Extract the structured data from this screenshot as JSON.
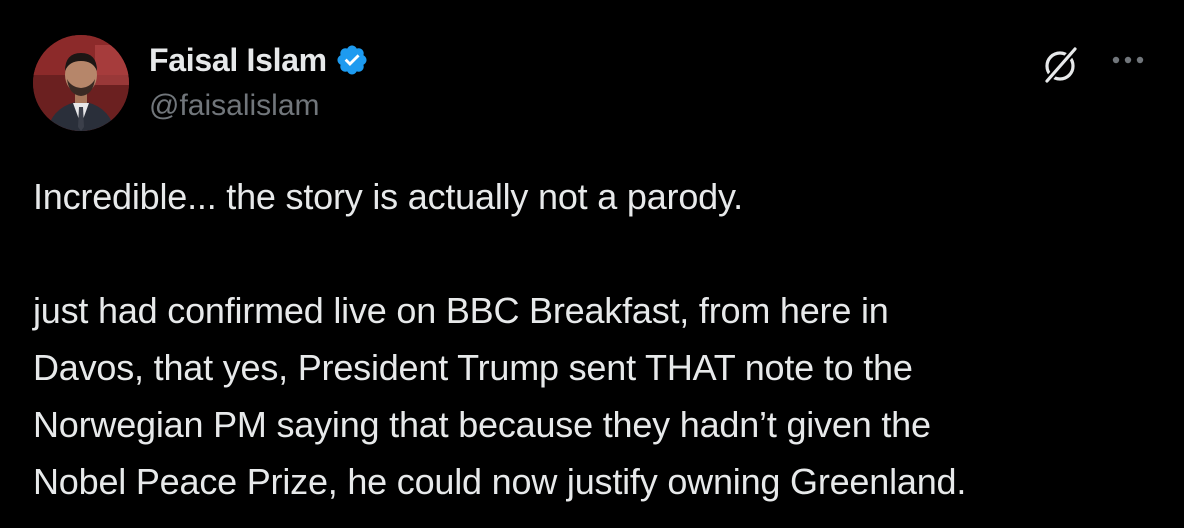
{
  "author": {
    "display_name": "Faisal Islam",
    "handle": "@faisalislam",
    "verified": true,
    "verified_color": "#1d9bf0"
  },
  "icons": {
    "grok": "grok-icon",
    "more": "more-options-icon",
    "verified": "verified-badge-icon"
  },
  "tweet": {
    "paragraph1": "Incredible... the story is actually not a parody.",
    "paragraph2_lines": [
      "just had confirmed live on BBC Breakfast, from here in",
      "Davos, that yes, President Trump sent THAT note to the",
      "Norwegian PM saying that because they hadn’t given the",
      "Nobel Peace Prize, he could now justify owning Greenland."
    ]
  },
  "colors": {
    "background": "#000000",
    "text_primary": "#e7e9ea",
    "text_secondary": "#71767b"
  }
}
